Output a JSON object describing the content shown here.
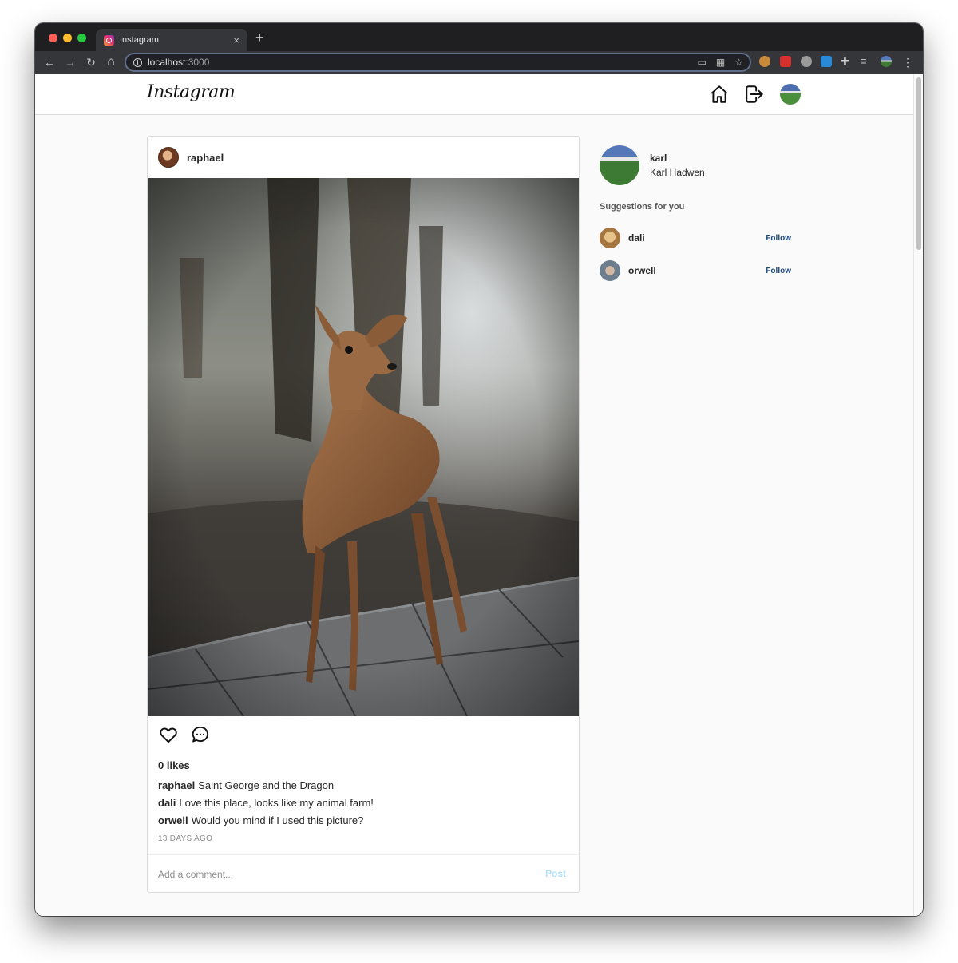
{
  "browser": {
    "tab_title": "Instagram",
    "tab_close": "×",
    "new_tab": "+",
    "url_host": "localhost",
    "url_port": ":3000",
    "nav_back": "←",
    "nav_forward": "→",
    "nav_reload": "↻",
    "nav_home": "⌂",
    "menu": "⋮"
  },
  "header": {
    "logo_text": "Instagram"
  },
  "post": {
    "username": "raphael",
    "likes": "0 likes",
    "comments": [
      {
        "user": "raphael",
        "text": "Saint George and the Dragon"
      },
      {
        "user": "dali",
        "text": "Love this place, looks like my animal farm!"
      },
      {
        "user": "orwell",
        "text": "Would you mind if I used this picture?"
      }
    ],
    "timestamp": "13 DAYS AGO",
    "comment_placeholder": "Add a comment...",
    "post_button": "Post"
  },
  "sidebar": {
    "username": "karl",
    "full_name": "Karl Hadwen",
    "suggestions_title": "Suggestions for you",
    "suggestions": [
      {
        "username": "dali",
        "action": "Follow"
      },
      {
        "username": "orwell",
        "action": "Follow"
      }
    ]
  },
  "colors": {
    "follow_blue": "#1f4b7a",
    "post_button_disabled": "#b2dffc"
  }
}
